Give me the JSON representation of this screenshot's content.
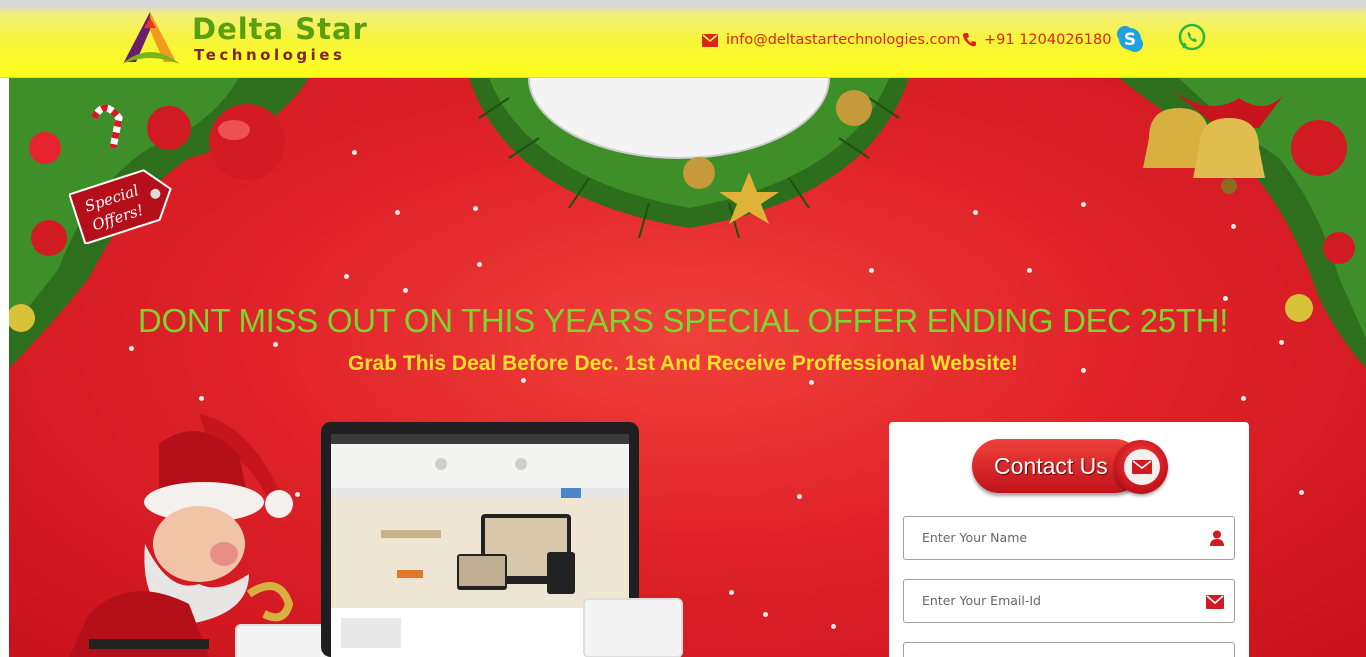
{
  "header": {
    "logo_title": "Delta Star",
    "logo_subtitle": "Technologies",
    "email": "info@deltastartechnologies.com",
    "phone": "+91 1204026180",
    "icons": [
      "envelope-icon",
      "phone-icon",
      "skype-icon",
      "whatsapp-icon"
    ]
  },
  "banner": {
    "tag_text": "Special Offers!",
    "headline": "DONT MISS OUT ON THIS YEARS SPECIAL OFFER ENDING DEC 25TH!",
    "subline": "Grab This Deal Before Dec. 1st And Receive Proffessional Website!"
  },
  "form": {
    "button_label": "Contact Us",
    "name_placeholder": "Enter Your Name",
    "email_placeholder": "Enter Your Email-Id"
  },
  "colors": {
    "header_yellow": "#ffff1a",
    "banner_red": "#e0232a",
    "headline_green": "#7bd630",
    "subline_yellow": "#f5e12a",
    "accent_red": "#d9251d"
  }
}
